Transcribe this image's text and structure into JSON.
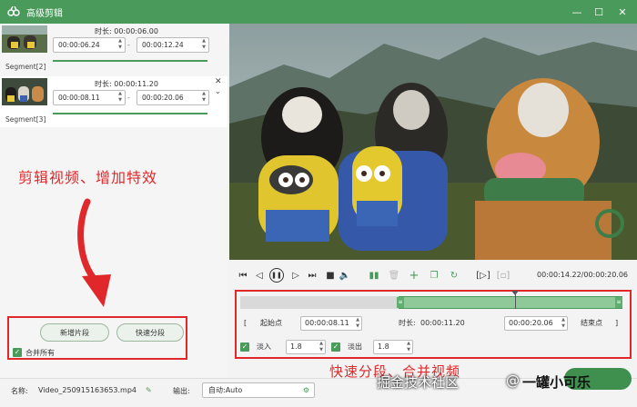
{
  "window": {
    "title": "高级剪辑",
    "min": "—",
    "max": "☐",
    "close": "✕"
  },
  "segments": [
    {
      "label": "Segment[2]",
      "duration_label": "时长:",
      "duration": "00:00:06.00",
      "start": "00:00:06.24",
      "end": "00:00:12.24",
      "dash": "-",
      "progress": 1.0
    },
    {
      "label": "Segment[3]",
      "duration_label": "时长:",
      "duration": "00:00:11.20",
      "start": "00:00:08.11",
      "end": "00:00:20.06",
      "dash": "-",
      "progress": 1.0
    }
  ],
  "annotations": {
    "top": "剪辑视频、增加特效",
    "bottom": "快速分段、合并视频"
  },
  "left_buttons": {
    "add_segment": "新增片段",
    "quick_split": "快速分段",
    "merge_all": "合并所有"
  },
  "playback": {
    "time_readout": "00:00:14.22/00:00:20.06"
  },
  "timeline": {
    "start_label": "起始点",
    "start_value": "00:00:08.11",
    "duration_label": "时长:",
    "duration_value": "00:00:11.20",
    "end_value": "00:00:20.06",
    "end_label": "结束点",
    "bracket_open": "[",
    "bracket_close": "]",
    "selection_start": 0.415,
    "selection_end": 1.0,
    "playhead": 0.72
  },
  "fade": {
    "fade_in_label": "淡入",
    "fade_in_value": "1.8",
    "fade_out_label": "淡出",
    "fade_out_value": "1.8"
  },
  "bottom": {
    "name_label": "名称:",
    "name_value": "Video_250915163653.mp4",
    "output_label": "输出:",
    "output_value": "自动:Auto"
  },
  "watermark": {
    "part1": "掘金技术社区",
    "part2": "@",
    "part3": "一罐小可乐"
  },
  "colors": {
    "accent": "#4a9a5b",
    "annotation": "#e0282a"
  }
}
